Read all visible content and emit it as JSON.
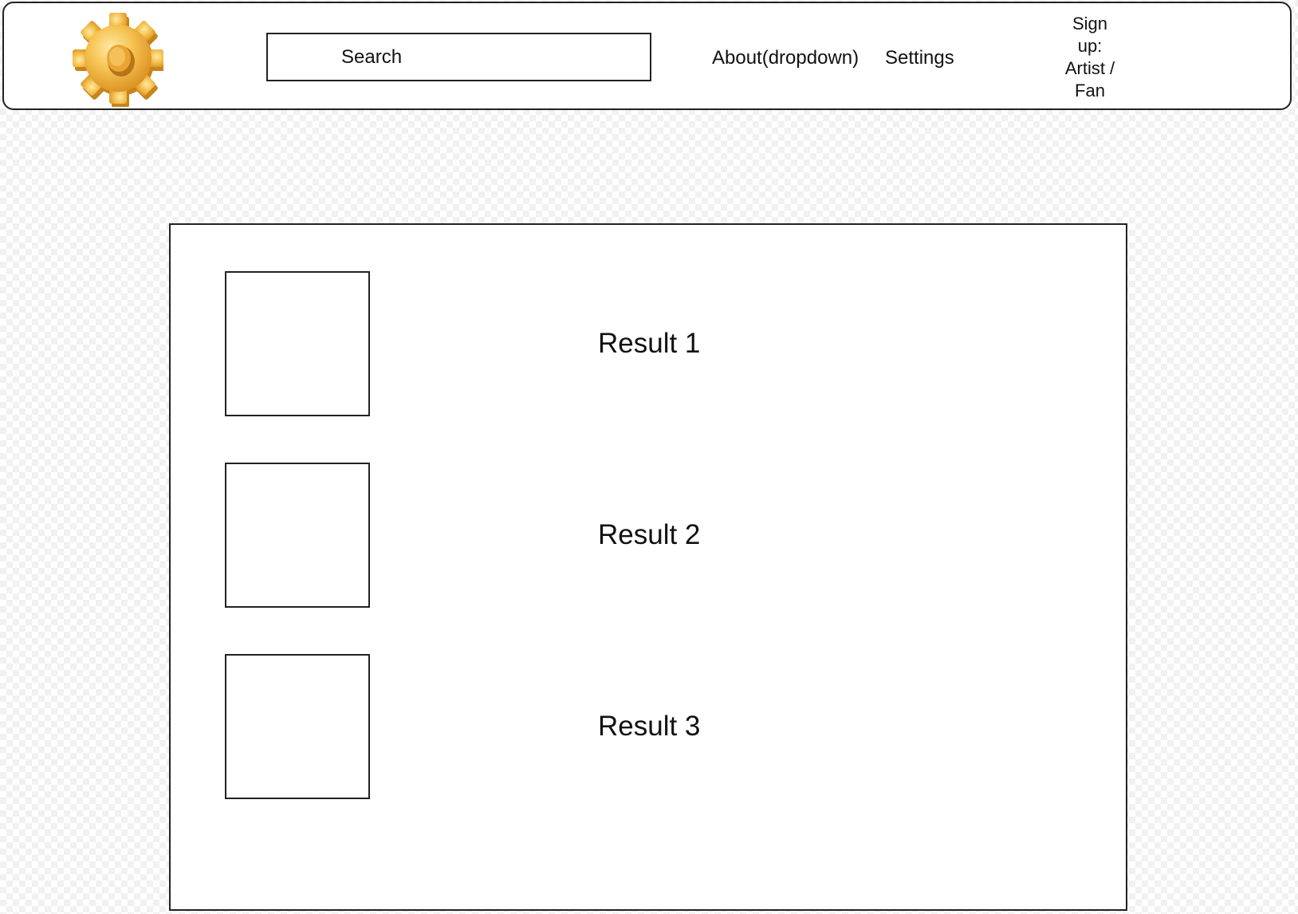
{
  "header": {
    "logo_icon": "gear-icon",
    "search": {
      "placeholder": "Search",
      "value": ""
    },
    "nav": {
      "about_label": "About(dropdown)",
      "settings_label": "Settings"
    },
    "signup": {
      "lines": [
        "Sign",
        "up:",
        "Artist /",
        "Fan"
      ]
    }
  },
  "results": [
    {
      "label": "Result 1"
    },
    {
      "label": "Result 2"
    },
    {
      "label": "Result 3"
    }
  ],
  "colors": {
    "logo_gold": "#f2b63c",
    "border": "#222222"
  }
}
